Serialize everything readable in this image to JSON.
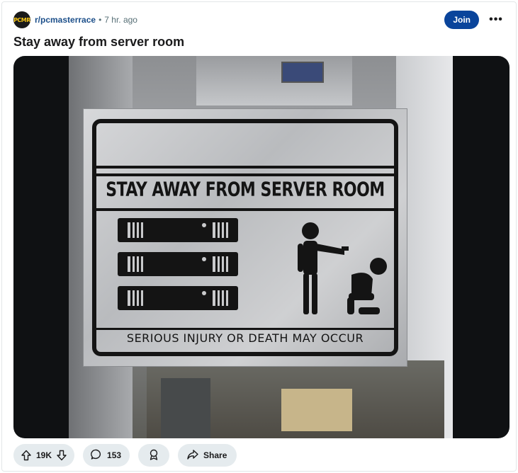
{
  "post": {
    "subreddit": "r/pcmasterrace",
    "avatar_text": "PCMR",
    "separator": "•",
    "time": "7 hr. ago",
    "join_label": "Join",
    "more_label": "•••",
    "title": "Stay away from server room"
  },
  "image": {
    "sign_heading": "STAY AWAY FROM SERVER ROOM",
    "sign_footer": "SERIOUS INJURY OR DEATH MAY OCCUR"
  },
  "actions": {
    "upvotes": "19K",
    "comments": "153",
    "share_label": "Share"
  },
  "icons": {
    "upvote": "upvote-arrow-icon",
    "downvote": "downvote-arrow-icon",
    "comment": "speech-bubble-icon",
    "award": "award-ribbon-icon",
    "share": "share-arrow-icon",
    "more": "ellipsis-icon"
  },
  "colors": {
    "join_button": "#0a449b",
    "subreddit_link": "#1c4f8a",
    "pill_bg": "#e5ebee",
    "media_bg": "#0f1113"
  }
}
